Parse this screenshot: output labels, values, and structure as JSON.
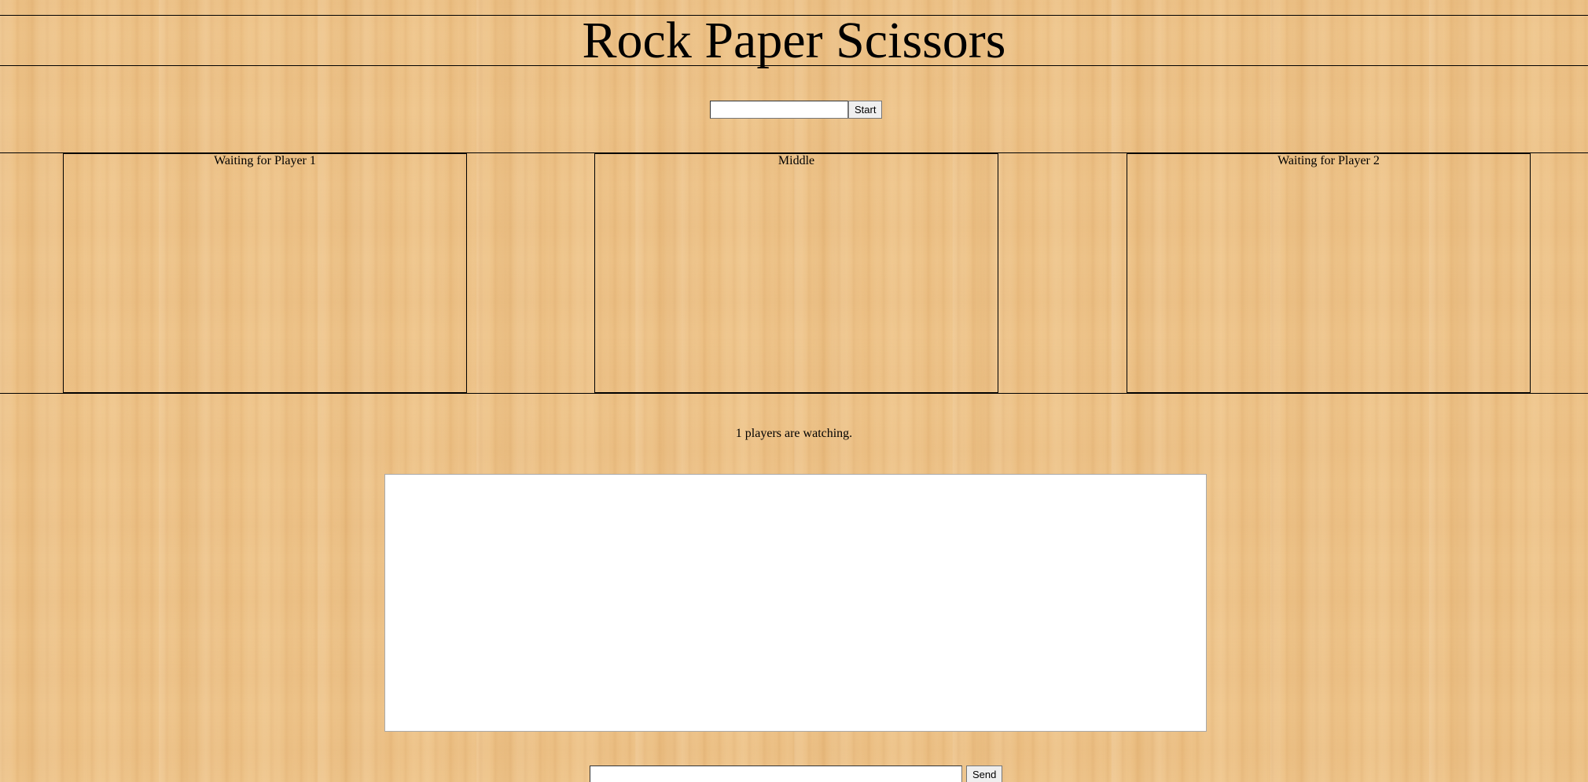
{
  "header": {
    "title": "Rock Paper Scissors"
  },
  "start_form": {
    "name_value": "",
    "name_placeholder": "",
    "start_label": "Start"
  },
  "panels": {
    "player1": "Waiting for Player 1",
    "middle": "Middle",
    "player2": "Waiting for Player 2"
  },
  "status": {
    "watching": "1 players are watching."
  },
  "chat": {
    "log_text": "",
    "input_value": "",
    "input_placeholder": "",
    "send_label": "Send"
  },
  "colors": {
    "background": "#eec48a",
    "chat_background": "#ffffff",
    "border": "#000000"
  }
}
